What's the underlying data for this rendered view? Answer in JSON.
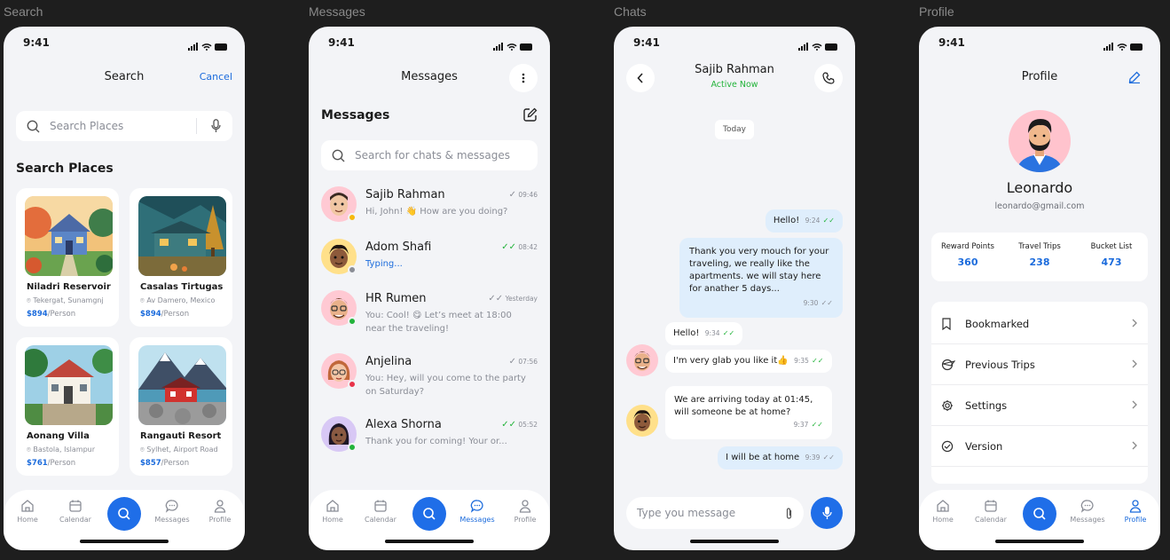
{
  "frames": {
    "search": "Search",
    "messages": "Messages",
    "chats": "Chats",
    "profile": "Profile"
  },
  "status_time": "9:41",
  "nav": {
    "home": "Home",
    "calendar": "Calendar",
    "messages": "Messages",
    "profile": "Profile"
  },
  "search_screen": {
    "title": "Search",
    "cancel": "Cancel",
    "placeholder": "Search Places",
    "section": "Search Places",
    "places": [
      {
        "name": "Niladri Reservoir",
        "location": "Tekergat, Sunamgnj",
        "price": "$894",
        "unit": "/Person"
      },
      {
        "name": "Casalas Tirtugas",
        "location": "Av Damero, Mexico",
        "price": "$894",
        "unit": "/Person"
      },
      {
        "name": "Aonang Villa",
        "location": "Bastola, Islampur",
        "price": "$761",
        "unit": "/Person"
      },
      {
        "name": "Rangauti Resort",
        "location": "Sylhet, Airport Road",
        "price": "$857",
        "unit": "/Person"
      }
    ]
  },
  "messages_screen": {
    "title": "Messages",
    "section": "Messages",
    "placeholder": "Search for chats & messages",
    "conversations": [
      {
        "name": "Sajib  Rahman",
        "preview": "Hi, John! 👋 How are you doing?",
        "time": "09:46"
      },
      {
        "name": "Adom Shafi",
        "preview": "Typing...",
        "time": "08:42"
      },
      {
        "name": "HR Rumen",
        "preview": "You: Cool! 😋 Let’s meet at 18:00 near the traveling!",
        "time": "Yesterday"
      },
      {
        "name": "Anjelina",
        "preview": "You: Hey, will you come to the party on Saturday?",
        "time": "07:56"
      },
      {
        "name": "Alexa Shorna",
        "preview": "Thank you for coming! Your or...",
        "time": "05:52"
      }
    ]
  },
  "chat_screen": {
    "contact": "Sajib Rahman",
    "status": "Active Now",
    "date": "Today",
    "messages": [
      {
        "text": "Hello!",
        "time": "9:24"
      },
      {
        "text": "Thank you very mouch for your traveling, we really like the apartments. we will stay here for anather 5 days...",
        "time": "9:30"
      },
      {
        "text": "Hello!",
        "time": "9:34"
      },
      {
        "text": "I'm very glab you like it👍",
        "time": "9:35"
      },
      {
        "text": "We are arriving today at 01:45, will someone be at home?",
        "time": "9:37"
      },
      {
        "text": "I will be at home",
        "time": "9:39"
      }
    ],
    "placeholder": "Type you message"
  },
  "profile_screen": {
    "title": "Profile",
    "name": "Leonardo",
    "email": "leonardo@gmail.com",
    "stats": [
      {
        "label": "Reward Points",
        "value": "360"
      },
      {
        "label": "Travel Trips",
        "value": "238"
      },
      {
        "label": "Bucket List",
        "value": "473"
      }
    ],
    "menu": [
      "Bookmarked",
      "Previous Trips",
      "Settings",
      "Version"
    ]
  },
  "colors": {
    "accent": "#1f6ee8",
    "online": "#22b33a",
    "away": "#f6b90d",
    "busy": "#e8334a",
    "offline": "#8a8d96"
  }
}
